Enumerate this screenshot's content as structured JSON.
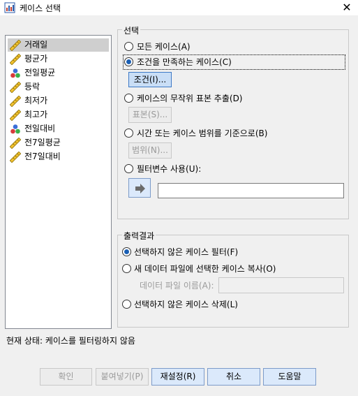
{
  "window": {
    "title": "케이스 선택",
    "close_symbol": "✕"
  },
  "variables": [
    {
      "label": "거래일",
      "icon": "ruler-scale-icon",
      "selected": true
    },
    {
      "label": "평균가",
      "icon": "ruler-scale-icon"
    },
    {
      "label": "전일평균",
      "icon": "nominal-balls-icon"
    },
    {
      "label": "등락",
      "icon": "ruler-scale-icon"
    },
    {
      "label": "최저가",
      "icon": "ruler-scale-icon"
    },
    {
      "label": "최고가",
      "icon": "ruler-scale-icon"
    },
    {
      "label": "전일대비",
      "icon": "nominal-balls-icon"
    },
    {
      "label": "전7일평균",
      "icon": "ruler-scale-icon"
    },
    {
      "label": "전7일대비",
      "icon": "ruler-scale-icon"
    }
  ],
  "select": {
    "legend": "선택",
    "all_cases": "모든 케이스(A)",
    "if_condition": "조건을 만족하는 케이스(C)",
    "if_button": "조건(I)...",
    "random_sample": "케이스의 무작위 표본 추출(D)",
    "sample_button": "표본(S)...",
    "range": "시간 또는 케이스 범위를 기준으로(B)",
    "range_button": "범위(N)...",
    "filter_var": "필터변수 사용(U):",
    "filter_value": ""
  },
  "output": {
    "legend": "출력결과",
    "filter_out": "선택하지 않은 케이스 필터(F)",
    "copy_to_new": "새 데이터 파일에 선택한 케이스 복사(O)",
    "dataset_label": "데이터 파일 이름(A):",
    "dataset_value": "",
    "delete_unselected": "선택하지 않은 케이스 삭제(L)"
  },
  "status": "현재 상태: 케이스를 필터링하지 않음",
  "buttons": {
    "ok": "확인",
    "paste": "붙여넣기(P)",
    "reset": "재설정(R)",
    "cancel": "취소",
    "help": "도움말"
  },
  "selection_state": {
    "select_mode": "if_condition",
    "output_mode": "filter_out"
  }
}
